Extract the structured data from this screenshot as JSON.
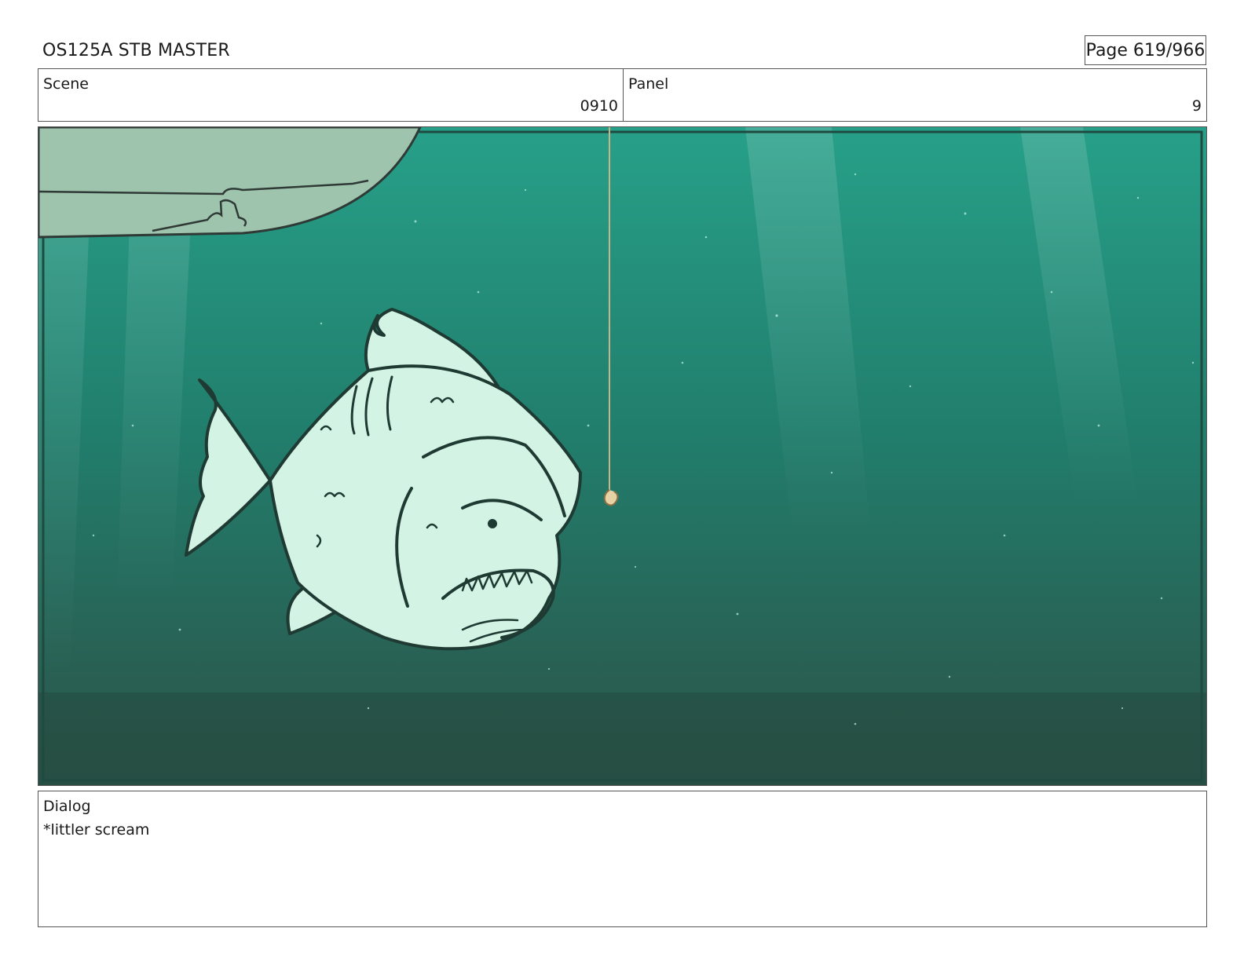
{
  "header": {
    "title": "OS125A STB MASTER",
    "page": "Page 619/966"
  },
  "scene": {
    "label": "Scene",
    "value": "0910"
  },
  "panel": {
    "label": "Panel",
    "value": "9"
  },
  "dialog": {
    "label": "Dialog",
    "text": "*littler scream"
  },
  "artwork": {
    "water_color_top": "#27a089",
    "water_color_bottom": "#2c5248",
    "fish_fill": "#d3f4e5",
    "boat_fill": "#9ec4ae"
  }
}
